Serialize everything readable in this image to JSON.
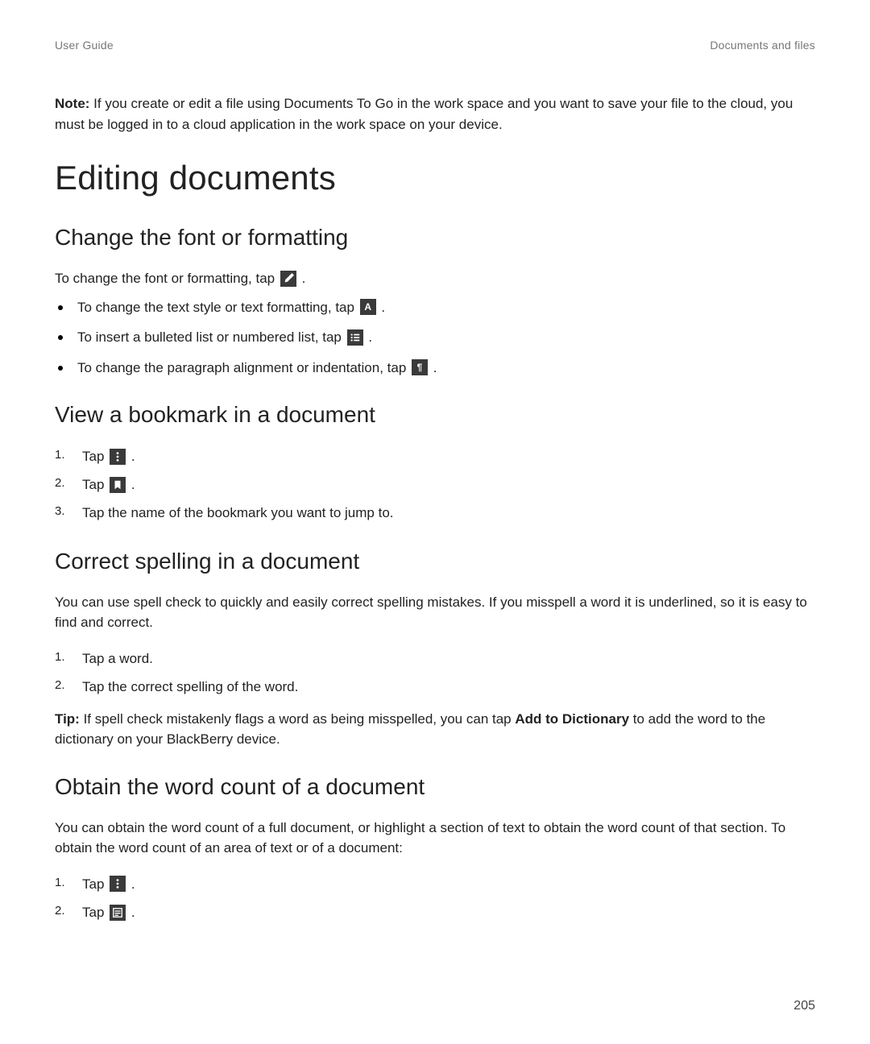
{
  "header": {
    "left": "User Guide",
    "right": "Documents and files"
  },
  "note": {
    "label": "Note:",
    "text": " If you create or edit a file using Documents To Go in the work space and you want to save your file to the cloud, you must be logged in to a cloud application in the work space on your device."
  },
  "h1": "Editing documents",
  "section_font": {
    "heading": "Change the font or formatting",
    "intro_pre": "To change the font or formatting, tap ",
    "intro_post": " .",
    "bullets": [
      {
        "pre": "To change the text style or text formatting, tap ",
        "post": " ."
      },
      {
        "pre": "To insert a bulleted list or numbered list, tap ",
        "post": " ."
      },
      {
        "pre": "To change the paragraph alignment or indentation, tap ",
        "post": " ."
      }
    ]
  },
  "section_bookmark": {
    "heading": "View a bookmark in a document",
    "steps": [
      {
        "num": "1.",
        "pre": "Tap ",
        "post": " ."
      },
      {
        "num": "2.",
        "pre": "Tap ",
        "post": " ."
      },
      {
        "num": "3.",
        "text": "Tap the name of the bookmark you want to jump to."
      }
    ]
  },
  "section_spell": {
    "heading": "Correct spelling in a document",
    "intro": "You can use spell check to quickly and easily correct spelling mistakes. If you misspell a word it is underlined, so it is easy to find and correct.",
    "steps": [
      {
        "num": "1.",
        "text": "Tap a word."
      },
      {
        "num": "2.",
        "text": "Tap the correct spelling of the word."
      }
    ],
    "tip_label": "Tip:",
    "tip_pre": " If spell check mistakenly flags a word as being misspelled, you can tap ",
    "tip_bold": "Add to Dictionary",
    "tip_post": " to add the word to the dictionary on your BlackBerry device."
  },
  "section_wordcount": {
    "heading": "Obtain the word count of a document",
    "intro": "You can obtain the word count of a full document, or highlight a section of text to obtain the word count of that section. To obtain the word count of an area of text or of a document:",
    "steps": [
      {
        "num": "1.",
        "pre": "Tap ",
        "post": " ."
      },
      {
        "num": "2.",
        "pre": "Tap ",
        "post": " ."
      }
    ]
  },
  "page_number": "205"
}
